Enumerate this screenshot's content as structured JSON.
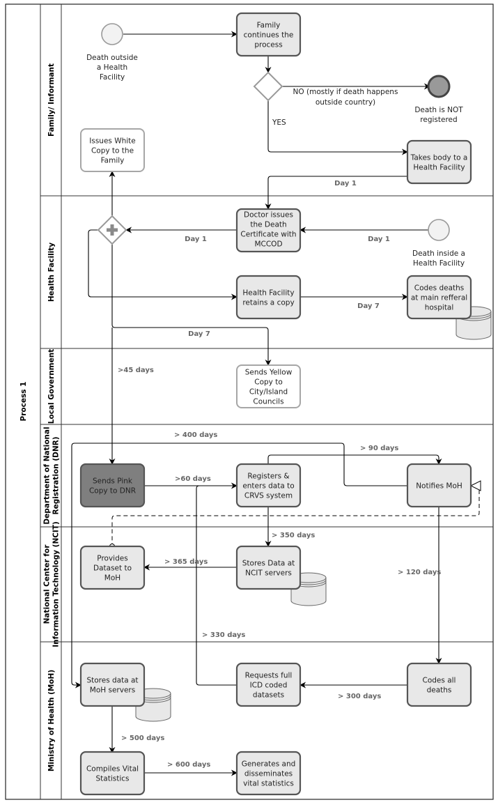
{
  "pool": {
    "title": "Process 1"
  },
  "lanes": [
    {
      "id": "family",
      "label": [
        "Family/ Informant"
      ]
    },
    {
      "id": "hf",
      "label": [
        "Health Facility"
      ]
    },
    {
      "id": "lg",
      "label": [
        "Local Government"
      ]
    },
    {
      "id": "dnr",
      "label": [
        "Department of National",
        "Registration (DNR)"
      ]
    },
    {
      "id": "ncit",
      "label": [
        "National Center for",
        "Information Technology (NCIT)"
      ]
    },
    {
      "id": "moh",
      "label": [
        "Ministry of Health (MoH)"
      ]
    }
  ],
  "events": [
    {
      "id": "start_outside",
      "type": "start",
      "label": [
        "Death outside",
        "a Health",
        "Facility"
      ]
    },
    {
      "id": "end_not_registered",
      "type": "end",
      "label": [
        "Death is NOT",
        "registered"
      ]
    },
    {
      "id": "start_inside",
      "type": "start",
      "label": [
        "Death inside a",
        "Health Facility"
      ]
    }
  ],
  "gateways": [
    {
      "id": "gw_decision",
      "type": "exclusive"
    },
    {
      "id": "gw_parallel",
      "type": "parallel"
    }
  ],
  "tasks": [
    {
      "id": "family_continues",
      "label": [
        "Family",
        "continues the",
        "process"
      ],
      "style": "normal"
    },
    {
      "id": "takes_body",
      "label": [
        "Takes body to a",
        "Health Facility"
      ],
      "style": "normal"
    },
    {
      "id": "issues_white",
      "label": [
        "Issues White",
        "Copy to the",
        "Family"
      ],
      "style": "light"
    },
    {
      "id": "doctor_issues",
      "label": [
        "Doctor issues",
        "the Death",
        "Certificate with",
        "MCCOD"
      ],
      "style": "normal"
    },
    {
      "id": "hf_retains",
      "label": [
        "Health Facility",
        "retains a copy"
      ],
      "style": "normal"
    },
    {
      "id": "codes_deaths_hospital",
      "label": [
        "Codes deaths",
        "at main refferal",
        "hospital"
      ],
      "style": "normal"
    },
    {
      "id": "sends_yellow",
      "label": [
        "Sends Yellow",
        "Copy to",
        "City/Island",
        "Councils"
      ],
      "style": "light"
    },
    {
      "id": "sends_pink",
      "label": [
        "Sends Pink",
        "Copy to DNR"
      ],
      "style": "dark"
    },
    {
      "id": "registers",
      "label": [
        "Registers &",
        "enters data to",
        "CRVS system"
      ],
      "style": "normal"
    },
    {
      "id": "notifies_moh",
      "label": [
        "Notifies MoH"
      ],
      "style": "normal"
    },
    {
      "id": "provides_dataset",
      "label": [
        "Provides",
        "Dataset to",
        "MoH"
      ],
      "style": "normal"
    },
    {
      "id": "stores_ncit",
      "label": [
        "Stores Data at",
        "NCIT servers"
      ],
      "style": "normal"
    },
    {
      "id": "stores_moh",
      "label": [
        "Stores data at",
        "MoH servers"
      ],
      "style": "normal"
    },
    {
      "id": "requests_icd",
      "label": [
        "Requests full",
        "ICD coded",
        "datasets"
      ],
      "style": "normal"
    },
    {
      "id": "codes_all",
      "label": [
        "Codes all",
        "deaths"
      ],
      "style": "normal"
    },
    {
      "id": "compiles_vital",
      "label": [
        "Compiles Vital",
        "Statistics"
      ],
      "style": "normal"
    },
    {
      "id": "generates_vital",
      "label": [
        "Generates and",
        "disseminates",
        "vital statistics"
      ],
      "style": "normal"
    }
  ],
  "datastores": [
    {
      "id": "ds_hospital"
    },
    {
      "id": "ds_ncit"
    },
    {
      "id": "ds_moh"
    }
  ],
  "edge_labels": {
    "no_branch": [
      "NO (mostly if death happens",
      "outside country)"
    ],
    "yes_branch": "YES",
    "takes_to_doctor": "Day 1",
    "doctor_to_gateway": "Day 1",
    "inside_to_doctor": "Day 1",
    "retains_to_codes": "Day 7",
    "gateway_to_yellow": "Day 7",
    "gateway_to_pink": ">45 days",
    "pink_to_registers": ">60 days",
    "registers_to_moh_servers": "> 400 days",
    "registers_to_notifies": "> 90 days",
    "registers_to_ncit": "> 350 days",
    "ncit_to_provides": "> 365 days",
    "notifies_to_codes": "> 120 days",
    "requests_to_registers": ">  330 days",
    "codes_to_requests": "> 300 days",
    "stores_to_compiles": "> 500 days",
    "compiles_to_generates": "> 600 days"
  },
  "colors": {
    "task_fill": "#e8e8e8",
    "task_stroke": "#555555",
    "task_dark_fill": "#7f7f7f",
    "light_stroke": "#a6a6a6",
    "end_fill": "#999999",
    "start_fill": "#f2f2f2",
    "edge_label": "#666666",
    "gateway_stroke": "#999999"
  }
}
